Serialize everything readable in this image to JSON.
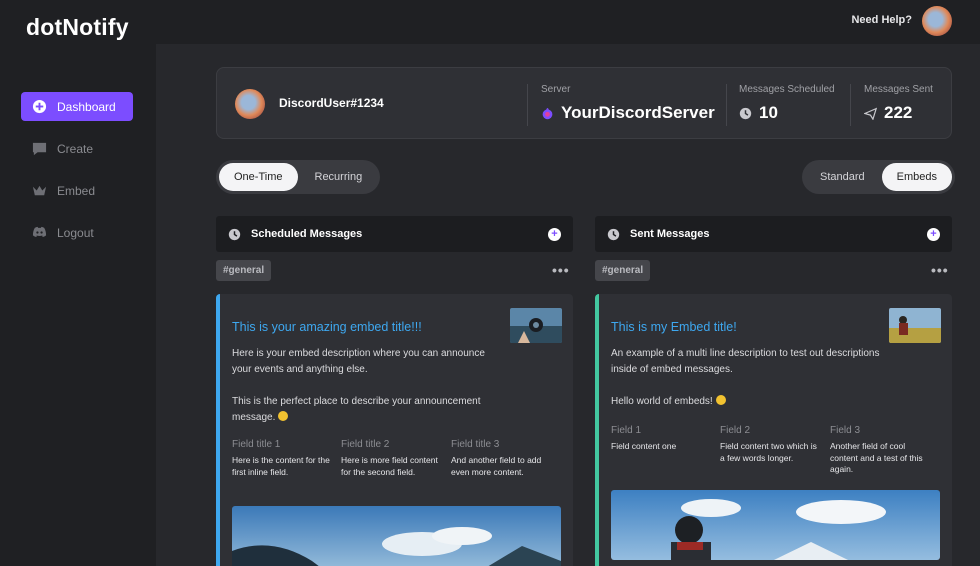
{
  "app": {
    "logo": "dotNotify",
    "accent": "#7c4dff"
  },
  "sidebar": {
    "items": [
      {
        "label": "Dashboard",
        "icon": "plus-circle-icon",
        "active": true
      },
      {
        "label": "Create",
        "icon": "chat-bubble-icon",
        "active": false
      },
      {
        "label": "Embed",
        "icon": "crown-icon",
        "active": false
      },
      {
        "label": "Logout",
        "icon": "discord-icon",
        "active": false
      }
    ]
  },
  "topbar": {
    "help_label": "Need Help?",
    "avatar_icon": "user-avatar"
  },
  "profile": {
    "username": "DiscordUser#1234",
    "server_label": "Server",
    "server_name": "YourDiscordServer",
    "scheduled_label": "Messages Scheduled",
    "scheduled_value": "10",
    "sent_label": "Messages Sent",
    "sent_value": "222"
  },
  "toggles": {
    "schedule_type": [
      "One-Time",
      "Recurring"
    ],
    "schedule_selected": "One-Time",
    "message_type": [
      "Standard",
      "Embeds"
    ],
    "message_selected": "Embeds"
  },
  "columns": [
    {
      "header": "Scheduled Messages",
      "channel": "#general",
      "accent": "#3ea8f0",
      "embed": {
        "title": "This is your amazing embed title!!!",
        "description": "Here is your embed description where you can announce your events and anything else.\n\n This is the perfect place to describe your announcement message.",
        "fields": [
          {
            "title": "Field title 1",
            "value": "Here is the content for the first inline field."
          },
          {
            "title": "Field title 2",
            "value": "Here is more field content for the second field."
          },
          {
            "title": "Field title 3",
            "value": "And another field to add even more content."
          }
        ]
      }
    },
    {
      "header": "Sent Messages",
      "channel": "#general",
      "accent": "#43c7a0",
      "embed": {
        "title": "This is my Embed title!",
        "description": "An example of a multi line description to test out descriptions inside of embed messages.\n\n Hello world of embeds!",
        "fields": [
          {
            "title": "Field 1",
            "value": "Field content one"
          },
          {
            "title": "Field 2",
            "value": "Field content two which is a few words longer."
          },
          {
            "title": "Field 3",
            "value": "Another field of cool content and a test of this again."
          }
        ]
      }
    }
  ]
}
